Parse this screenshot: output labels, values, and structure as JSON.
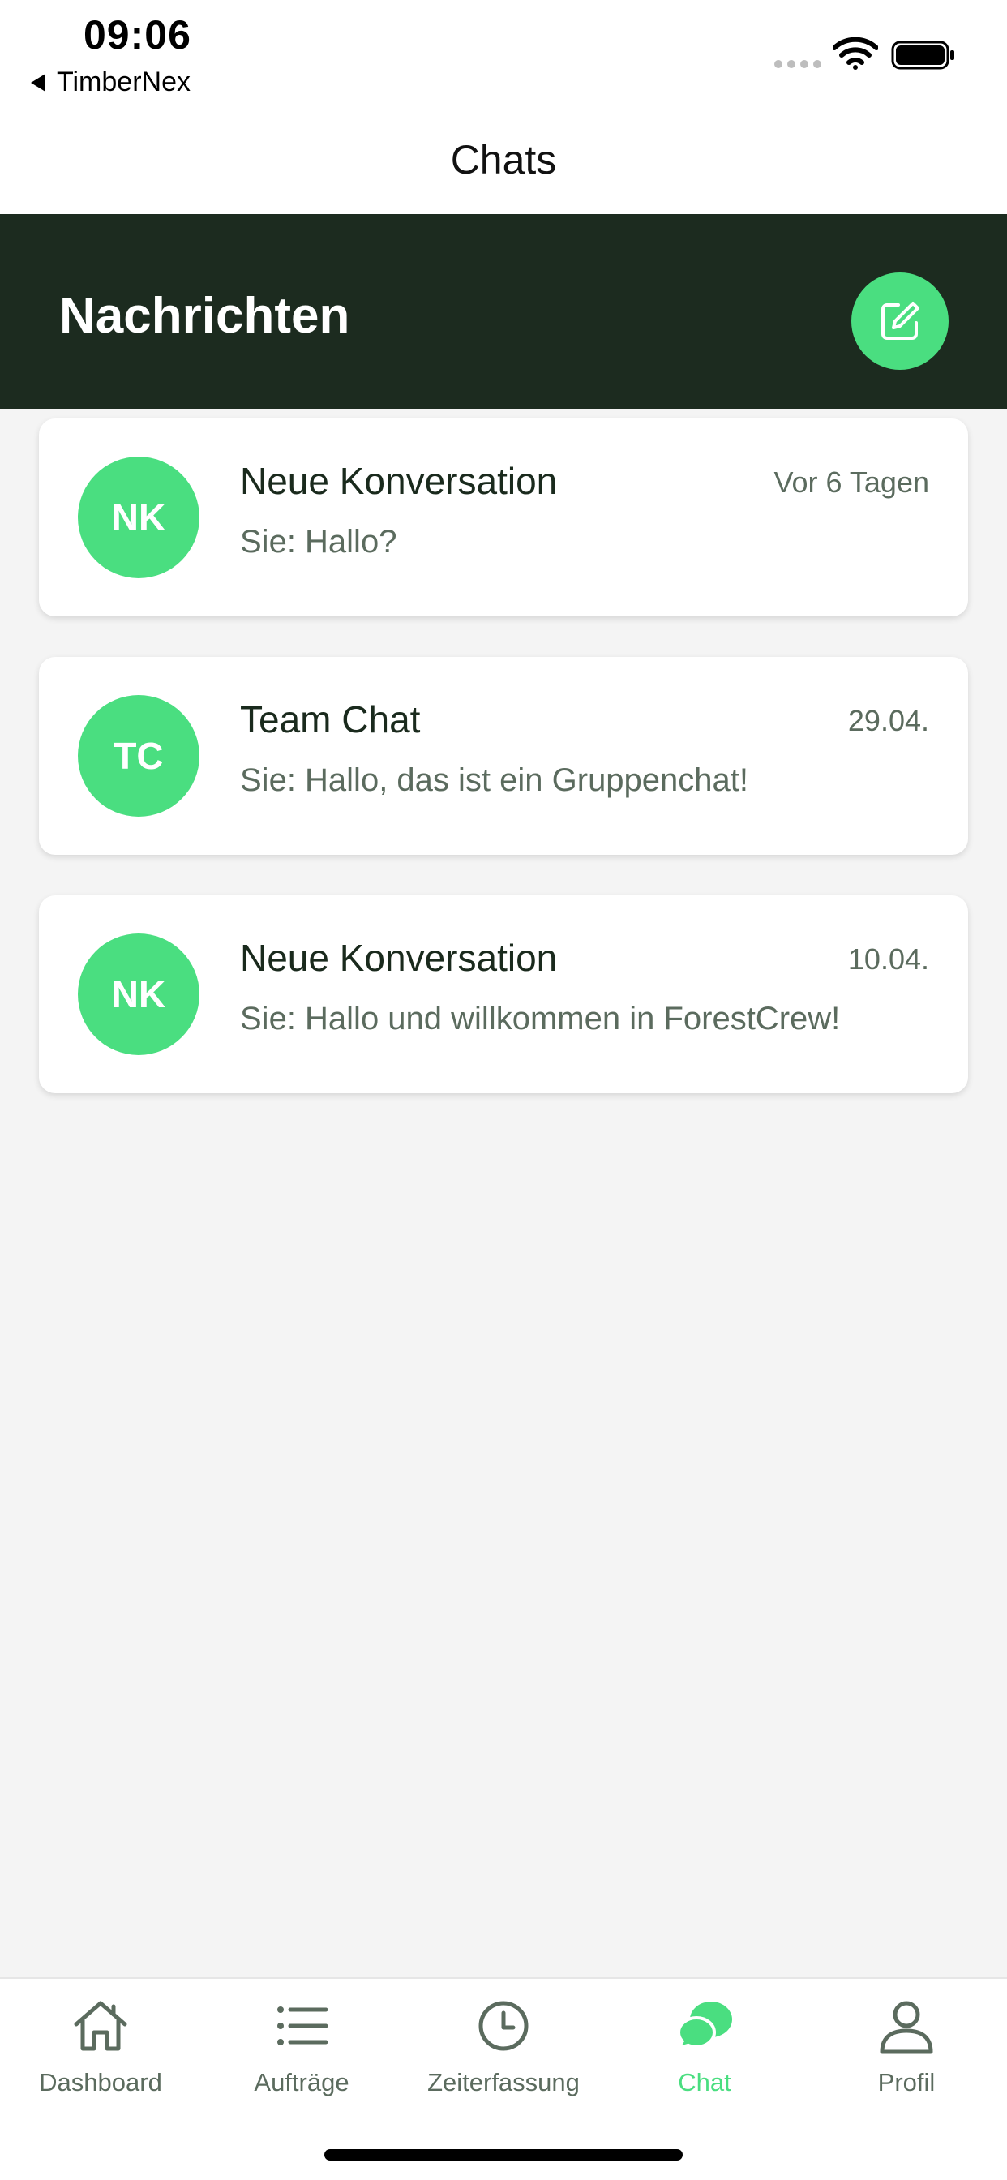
{
  "status_bar": {
    "time": "09:06",
    "back_app_label": "TimberNex"
  },
  "nav": {
    "title": "Chats"
  },
  "header": {
    "title": "Nachrichten",
    "compose_icon": "compose-icon"
  },
  "colors": {
    "header_bg": "#1c2b1f",
    "accent": "#4ade80",
    "text_dark": "#1a2a1d",
    "text_muted": "#5b6b5e"
  },
  "chats": [
    {
      "initials": "NK",
      "name": "Neue Konversation",
      "time": "Vor 6 Tagen",
      "preview": "Sie: Hallo?"
    },
    {
      "initials": "TC",
      "name": "Team Chat",
      "time": "29.04.",
      "preview": "Sie: Hallo, das ist ein Gruppenchat!"
    },
    {
      "initials": "NK",
      "name": "Neue Konversation",
      "time": "10.04.",
      "preview": "Sie: Hallo und willkommen in ForestCrew!"
    }
  ],
  "tabs": [
    {
      "label": "Dashboard",
      "icon": "home-icon",
      "active": false
    },
    {
      "label": "Aufträge",
      "icon": "list-icon",
      "active": false
    },
    {
      "label": "Zeiterfassung",
      "icon": "clock-icon",
      "active": false
    },
    {
      "label": "Chat",
      "icon": "chat-bubbles-icon",
      "active": true
    },
    {
      "label": "Profil",
      "icon": "person-icon",
      "active": false
    }
  ]
}
